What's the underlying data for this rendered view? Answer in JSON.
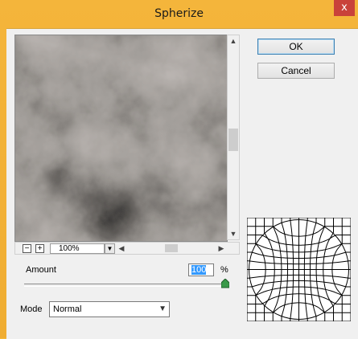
{
  "window": {
    "title": "Spherize",
    "close_glyph": "x"
  },
  "buttons": {
    "ok": "OK",
    "cancel": "Cancel"
  },
  "zoom": {
    "minus": "−",
    "plus": "+",
    "value": "100%"
  },
  "amount": {
    "label": "Amount",
    "value": "100",
    "unit": "%",
    "slider_fraction": 1.0
  },
  "mode": {
    "label": "Mode",
    "value": "Normal"
  },
  "icons": {
    "scroll_up": "up-arrow-icon",
    "scroll_down": "down-arrow-icon",
    "scroll_left": "left-arrow-icon",
    "scroll_right": "right-arrow-icon",
    "dropdown": "chevron-down-icon",
    "slider": "slider-triangle-icon",
    "close": "close-icon"
  },
  "colors": {
    "title_bar": "#f4b53b",
    "close_button": "#c9423a",
    "dialog_bg": "#f0f0f0",
    "ok_border": "#3c7fb1",
    "selection": "#3399ff",
    "slider_thumb": "#3a9a4a"
  }
}
